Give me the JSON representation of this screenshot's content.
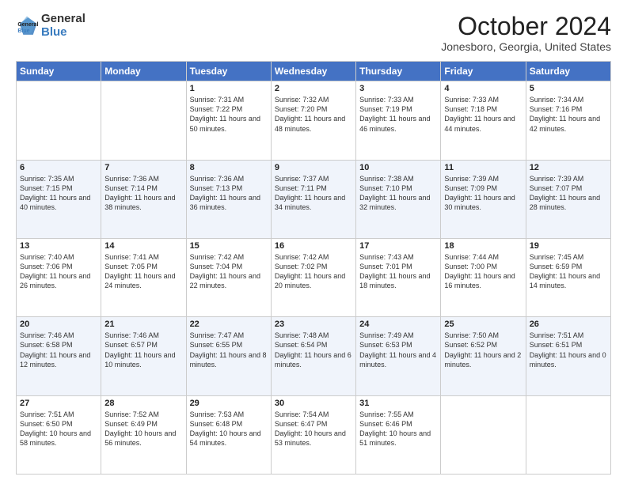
{
  "header": {
    "logo_line1": "General",
    "logo_line2": "Blue",
    "month": "October 2024",
    "location": "Jonesboro, Georgia, United States"
  },
  "days_of_week": [
    "Sunday",
    "Monday",
    "Tuesday",
    "Wednesday",
    "Thursday",
    "Friday",
    "Saturday"
  ],
  "weeks": [
    [
      {
        "day": "",
        "sunrise": "",
        "sunset": "",
        "daylight": ""
      },
      {
        "day": "",
        "sunrise": "",
        "sunset": "",
        "daylight": ""
      },
      {
        "day": "1",
        "sunrise": "Sunrise: 7:31 AM",
        "sunset": "Sunset: 7:22 PM",
        "daylight": "Daylight: 11 hours and 50 minutes."
      },
      {
        "day": "2",
        "sunrise": "Sunrise: 7:32 AM",
        "sunset": "Sunset: 7:20 PM",
        "daylight": "Daylight: 11 hours and 48 minutes."
      },
      {
        "day": "3",
        "sunrise": "Sunrise: 7:33 AM",
        "sunset": "Sunset: 7:19 PM",
        "daylight": "Daylight: 11 hours and 46 minutes."
      },
      {
        "day": "4",
        "sunrise": "Sunrise: 7:33 AM",
        "sunset": "Sunset: 7:18 PM",
        "daylight": "Daylight: 11 hours and 44 minutes."
      },
      {
        "day": "5",
        "sunrise": "Sunrise: 7:34 AM",
        "sunset": "Sunset: 7:16 PM",
        "daylight": "Daylight: 11 hours and 42 minutes."
      }
    ],
    [
      {
        "day": "6",
        "sunrise": "Sunrise: 7:35 AM",
        "sunset": "Sunset: 7:15 PM",
        "daylight": "Daylight: 11 hours and 40 minutes."
      },
      {
        "day": "7",
        "sunrise": "Sunrise: 7:36 AM",
        "sunset": "Sunset: 7:14 PM",
        "daylight": "Daylight: 11 hours and 38 minutes."
      },
      {
        "day": "8",
        "sunrise": "Sunrise: 7:36 AM",
        "sunset": "Sunset: 7:13 PM",
        "daylight": "Daylight: 11 hours and 36 minutes."
      },
      {
        "day": "9",
        "sunrise": "Sunrise: 7:37 AM",
        "sunset": "Sunset: 7:11 PM",
        "daylight": "Daylight: 11 hours and 34 minutes."
      },
      {
        "day": "10",
        "sunrise": "Sunrise: 7:38 AM",
        "sunset": "Sunset: 7:10 PM",
        "daylight": "Daylight: 11 hours and 32 minutes."
      },
      {
        "day": "11",
        "sunrise": "Sunrise: 7:39 AM",
        "sunset": "Sunset: 7:09 PM",
        "daylight": "Daylight: 11 hours and 30 minutes."
      },
      {
        "day": "12",
        "sunrise": "Sunrise: 7:39 AM",
        "sunset": "Sunset: 7:07 PM",
        "daylight": "Daylight: 11 hours and 28 minutes."
      }
    ],
    [
      {
        "day": "13",
        "sunrise": "Sunrise: 7:40 AM",
        "sunset": "Sunset: 7:06 PM",
        "daylight": "Daylight: 11 hours and 26 minutes."
      },
      {
        "day": "14",
        "sunrise": "Sunrise: 7:41 AM",
        "sunset": "Sunset: 7:05 PM",
        "daylight": "Daylight: 11 hours and 24 minutes."
      },
      {
        "day": "15",
        "sunrise": "Sunrise: 7:42 AM",
        "sunset": "Sunset: 7:04 PM",
        "daylight": "Daylight: 11 hours and 22 minutes."
      },
      {
        "day": "16",
        "sunrise": "Sunrise: 7:42 AM",
        "sunset": "Sunset: 7:02 PM",
        "daylight": "Daylight: 11 hours and 20 minutes."
      },
      {
        "day": "17",
        "sunrise": "Sunrise: 7:43 AM",
        "sunset": "Sunset: 7:01 PM",
        "daylight": "Daylight: 11 hours and 18 minutes."
      },
      {
        "day": "18",
        "sunrise": "Sunrise: 7:44 AM",
        "sunset": "Sunset: 7:00 PM",
        "daylight": "Daylight: 11 hours and 16 minutes."
      },
      {
        "day": "19",
        "sunrise": "Sunrise: 7:45 AM",
        "sunset": "Sunset: 6:59 PM",
        "daylight": "Daylight: 11 hours and 14 minutes."
      }
    ],
    [
      {
        "day": "20",
        "sunrise": "Sunrise: 7:46 AM",
        "sunset": "Sunset: 6:58 PM",
        "daylight": "Daylight: 11 hours and 12 minutes."
      },
      {
        "day": "21",
        "sunrise": "Sunrise: 7:46 AM",
        "sunset": "Sunset: 6:57 PM",
        "daylight": "Daylight: 11 hours and 10 minutes."
      },
      {
        "day": "22",
        "sunrise": "Sunrise: 7:47 AM",
        "sunset": "Sunset: 6:55 PM",
        "daylight": "Daylight: 11 hours and 8 minutes."
      },
      {
        "day": "23",
        "sunrise": "Sunrise: 7:48 AM",
        "sunset": "Sunset: 6:54 PM",
        "daylight": "Daylight: 11 hours and 6 minutes."
      },
      {
        "day": "24",
        "sunrise": "Sunrise: 7:49 AM",
        "sunset": "Sunset: 6:53 PM",
        "daylight": "Daylight: 11 hours and 4 minutes."
      },
      {
        "day": "25",
        "sunrise": "Sunrise: 7:50 AM",
        "sunset": "Sunset: 6:52 PM",
        "daylight": "Daylight: 11 hours and 2 minutes."
      },
      {
        "day": "26",
        "sunrise": "Sunrise: 7:51 AM",
        "sunset": "Sunset: 6:51 PM",
        "daylight": "Daylight: 11 hours and 0 minutes."
      }
    ],
    [
      {
        "day": "27",
        "sunrise": "Sunrise: 7:51 AM",
        "sunset": "Sunset: 6:50 PM",
        "daylight": "Daylight: 10 hours and 58 minutes."
      },
      {
        "day": "28",
        "sunrise": "Sunrise: 7:52 AM",
        "sunset": "Sunset: 6:49 PM",
        "daylight": "Daylight: 10 hours and 56 minutes."
      },
      {
        "day": "29",
        "sunrise": "Sunrise: 7:53 AM",
        "sunset": "Sunset: 6:48 PM",
        "daylight": "Daylight: 10 hours and 54 minutes."
      },
      {
        "day": "30",
        "sunrise": "Sunrise: 7:54 AM",
        "sunset": "Sunset: 6:47 PM",
        "daylight": "Daylight: 10 hours and 53 minutes."
      },
      {
        "day": "31",
        "sunrise": "Sunrise: 7:55 AM",
        "sunset": "Sunset: 6:46 PM",
        "daylight": "Daylight: 10 hours and 51 minutes."
      },
      {
        "day": "",
        "sunrise": "",
        "sunset": "",
        "daylight": ""
      },
      {
        "day": "",
        "sunrise": "",
        "sunset": "",
        "daylight": ""
      }
    ]
  ]
}
